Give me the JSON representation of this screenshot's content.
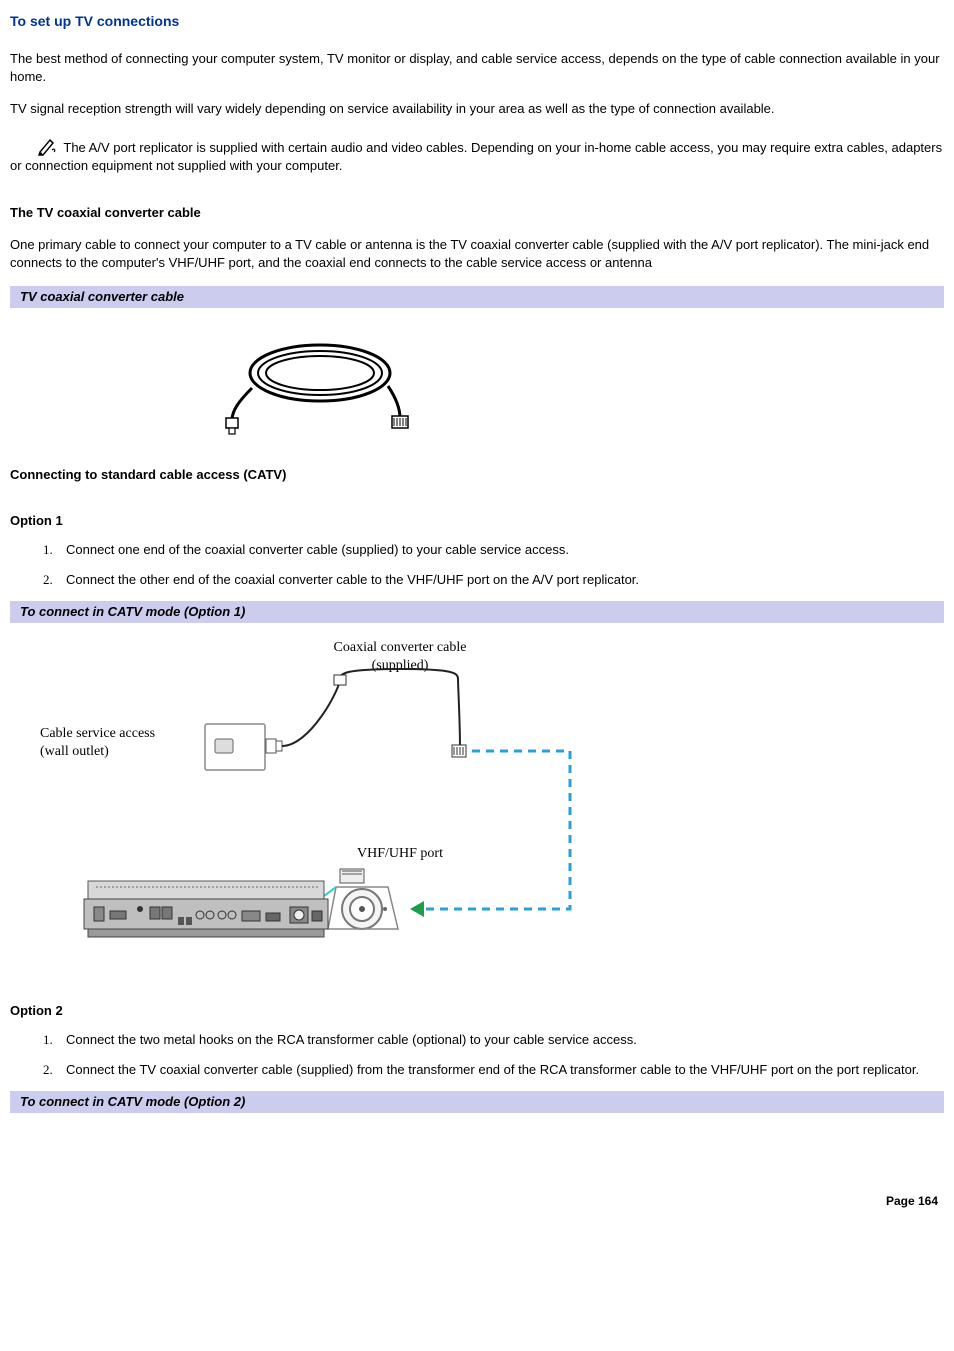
{
  "title": "To set up TV connections",
  "para1": "The best method of connecting your computer system, TV monitor or display, and cable service access, depends on the type of cable connection available in your home.",
  "para2": "TV signal reception strength will vary widely depending on service availability in your area as well as the type of connection available.",
  "note": "The A/V port replicator is supplied with certain audio and video cables. Depending on your in-home cable access, you may require extra cables, adapters or connection equipment not supplied with your computer.",
  "sectionA": {
    "heading": "The TV coaxial converter cable",
    "para": "One primary cable to connect your computer to a TV cable or antenna is the TV coaxial converter cable (supplied with the A/V port replicator). The mini-jack end connects to the computer's VHF/UHF port, and the coaxial end connects to the cable service access or antenna",
    "callout": "TV coaxial converter cable"
  },
  "sectionB": {
    "heading": "Connecting to standard cable access (CATV)"
  },
  "option1": {
    "heading": "Option 1",
    "steps": [
      "Connect one end of the coaxial converter cable (supplied) to your cable service access.",
      "Connect the other end of the coaxial converter cable to the VHF/UHF port on the A/V port replicator."
    ],
    "callout": "To connect in CATV mode (Option 1)",
    "diagram": {
      "label_cable": "Coaxial converter cable\n(supplied)",
      "label_wall": "Cable service access\n(wall outlet)",
      "label_port": "VHF/UHF port"
    }
  },
  "option2": {
    "heading": "Option 2",
    "steps": [
      "Connect the two metal hooks on the RCA transformer cable (optional) to your cable service access.",
      "Connect the TV coaxial converter cable (supplied) from the transformer end of the RCA transformer cable to the VHF/UHF port on the port replicator."
    ],
    "callout": "To connect in CATV mode (Option 2)"
  },
  "footer": "Page 164"
}
